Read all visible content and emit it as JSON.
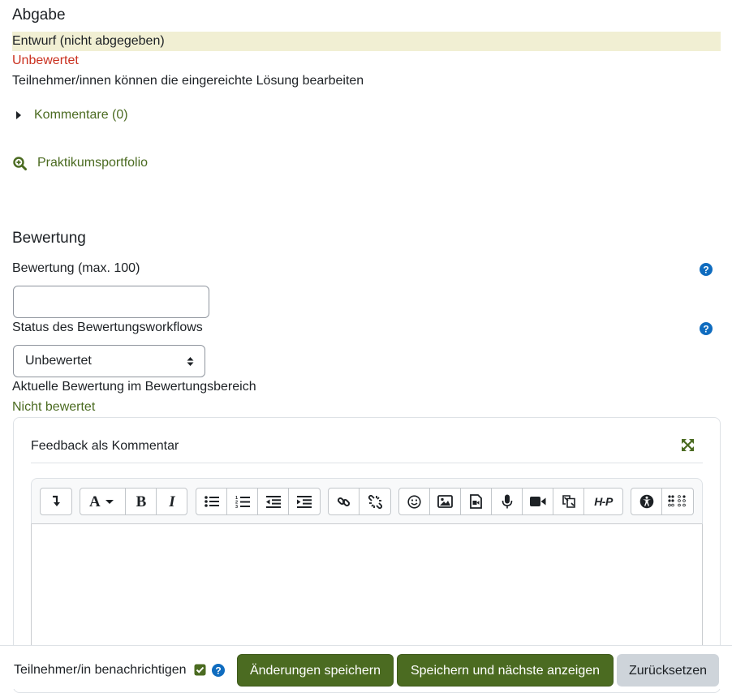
{
  "submission": {
    "heading": "Abgabe",
    "status": "Entwurf (nicht abgegeben)",
    "grading_status": "Unbewertet",
    "edit_note": "Teilnehmer/innen können die eingereichte Lösung bearbeiten",
    "comments_label": "Kommentare (0)",
    "file_link": "Praktikumsportfolio"
  },
  "grade": {
    "heading": "Bewertung",
    "score_label": "Bewertung (max. 100)",
    "score_value": "",
    "workflow_label": "Status des Bewertungsworkflows",
    "workflow_selected": "Unbewertet",
    "current_label": "Aktuelle Bewertung im Bewertungsbereich",
    "current_value": "Nicht bewertet"
  },
  "feedback": {
    "title": "Feedback als Kommentar",
    "expand_icon": "expand-arrows-icon",
    "toolbar_icons": [
      "collapse-toolbar-icon",
      "font-style-icon",
      "bold-icon",
      "italic-icon",
      "unordered-list-icon",
      "ordered-list-icon",
      "outdent-icon",
      "indent-icon",
      "link-icon",
      "unlink-icon",
      "emoji-icon",
      "image-icon",
      "media-file-icon",
      "record-audio-icon",
      "record-video-icon",
      "manage-files-icon",
      "h5p-icon",
      "accessibility-checker-icon",
      "braille-icon"
    ],
    "h5p_text": "H-P",
    "editor_content": ""
  },
  "footer": {
    "notify_label": "Teilnehmer/in benachrichtigen",
    "notify_checked": true,
    "save_label": "Änderungen speichern",
    "save_next_label": "Speichern und nächste anzeigen",
    "reset_label": "Zurücksetzen"
  },
  "colors": {
    "accent": "#4b6b21",
    "danger": "#ca3120",
    "highlight": "#f1efd3",
    "help": "#0f6cbf"
  }
}
